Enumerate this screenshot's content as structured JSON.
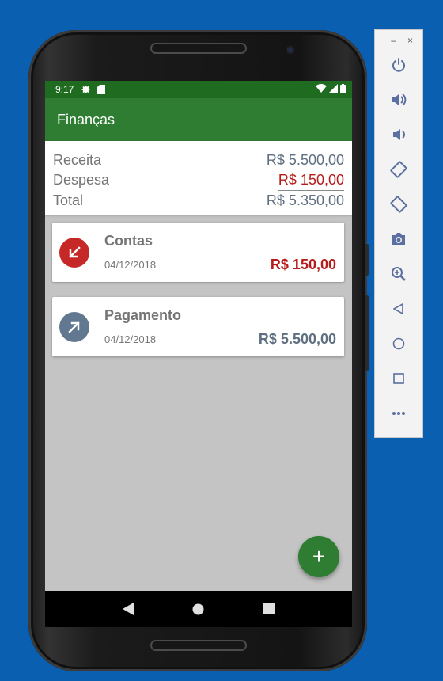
{
  "status_bar": {
    "time": "9:17"
  },
  "app_bar": {
    "title": "Finanças"
  },
  "summary": {
    "receita_label": "Receita",
    "receita_value": "R$  5.500,00",
    "despesa_label": "Despesa",
    "despesa_value": "R$  150,00",
    "total_label": "Total",
    "total_value": "R$  5.350,00"
  },
  "transactions": [
    {
      "title": "Contas",
      "date": "04/12/2018",
      "amount": "R$  150,00",
      "type": "despesa",
      "icon": "arrow-down-left-icon"
    },
    {
      "title": "Pagamento",
      "date": "04/12/2018",
      "amount": "R$  5.500,00",
      "type": "receita",
      "icon": "arrow-up-right-icon"
    }
  ],
  "fab": {
    "label": "+"
  },
  "emulator_toolbar": {
    "window_controls": [
      "–",
      "×"
    ],
    "buttons": [
      "power-icon",
      "volume-up-icon",
      "volume-down-icon",
      "rotate-left-icon",
      "rotate-right-icon",
      "camera-icon",
      "zoom-icon",
      "back-icon",
      "home-icon",
      "overview-icon",
      "more-icon"
    ]
  },
  "colors": {
    "primary": "#2e7d32",
    "primary_dark": "#1f6b1f",
    "expense_red": "#b71c1c",
    "income_slate": "#5f6f80",
    "desktop_bg": "#0a5fb0"
  }
}
